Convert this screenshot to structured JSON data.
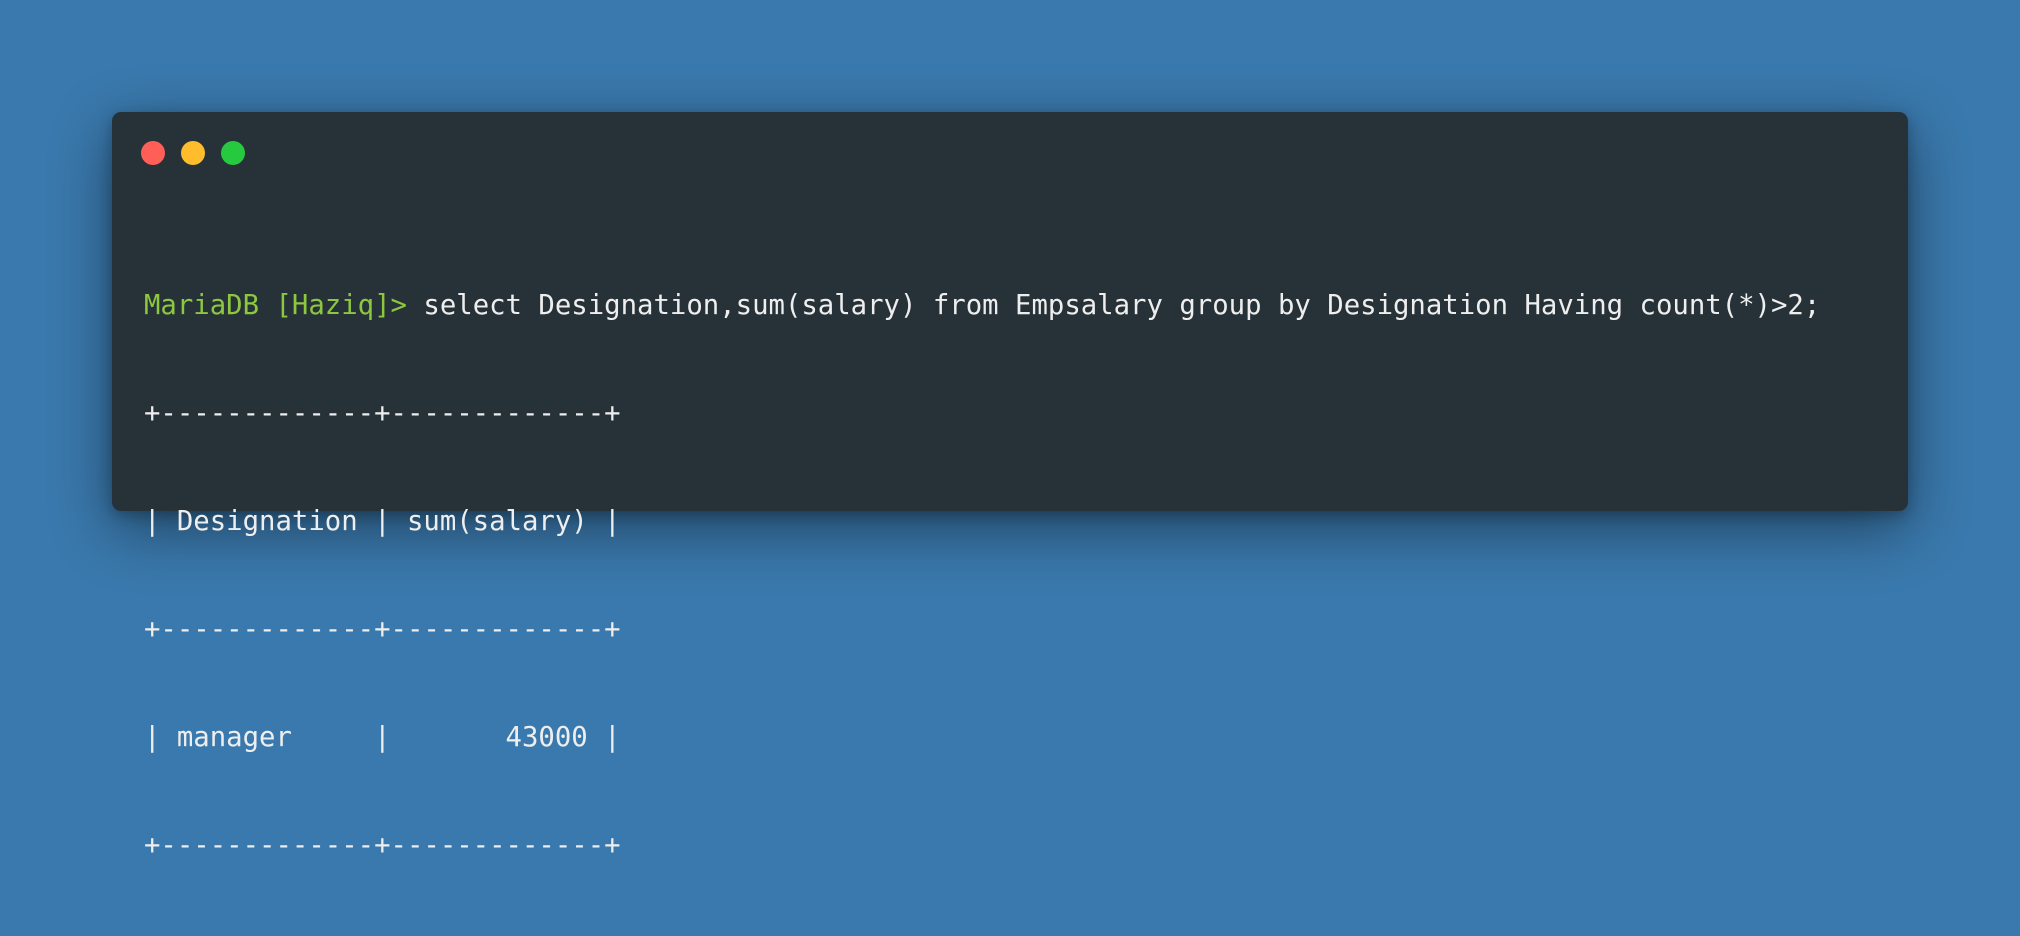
{
  "window": {
    "controls": [
      {
        "name": "close-window-button",
        "color": "#ff5f56"
      },
      {
        "name": "minimize-window-button",
        "color": "#ffbd2e"
      },
      {
        "name": "maximize-window-button",
        "color": "#27c93f"
      }
    ]
  },
  "terminal": {
    "prompt": "MariaDB [Haziq]>",
    "command": " select Designation,sum(salary) from Empsalary group by Designation Having count(*)>2;",
    "output": [
      "+-------------+-------------+",
      "| Designation | sum(salary) |",
      "+-------------+-------------+",
      "| manager     |       43000 |",
      "+-------------+-------------+"
    ],
    "colors": {
      "background": "#263238",
      "text": "#eeeeee",
      "prompt": "#8dc73f"
    }
  }
}
